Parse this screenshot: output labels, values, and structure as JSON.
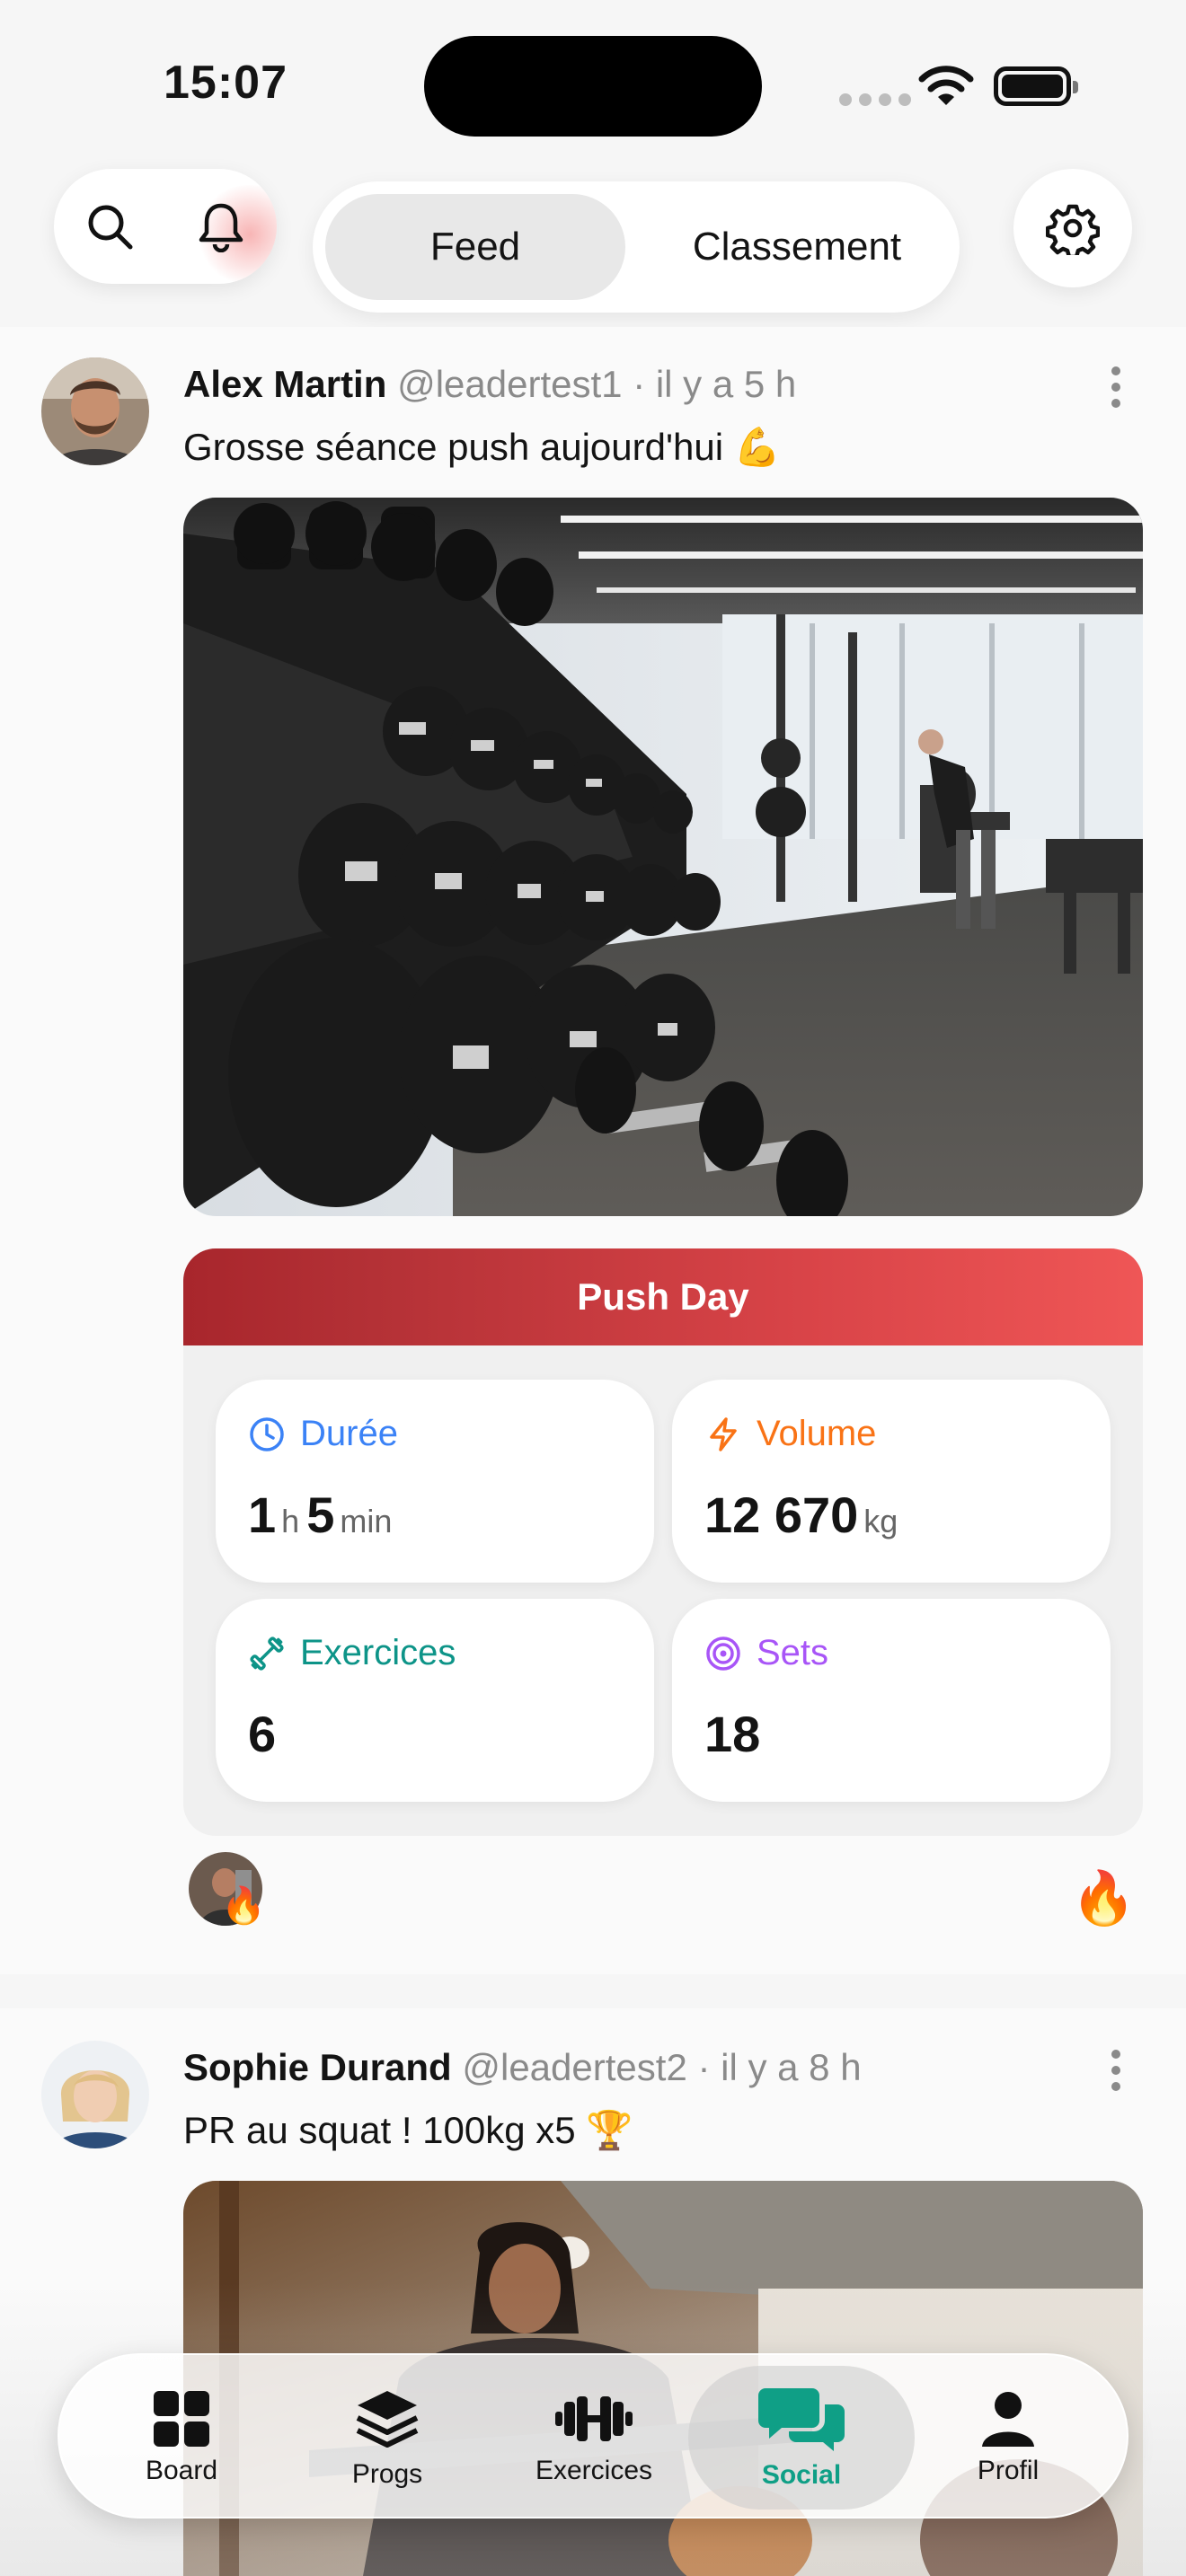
{
  "status_bar": {
    "time": "15:07"
  },
  "header": {
    "tabs": [
      {
        "label": "Feed",
        "active": true
      },
      {
        "label": "Classement",
        "active": false
      }
    ]
  },
  "posts": [
    {
      "name": "Alex Martin",
      "handle": "@leadertest1",
      "time": "· il y a 5 h",
      "text": "Grosse séance push aujourd'hui 💪",
      "workout": {
        "title": "Push Day",
        "stats": [
          {
            "label": "Durée",
            "value_h": "1",
            "unit_h": "h",
            "value_m": "5",
            "unit_m": "min",
            "color": "#3b82f6"
          },
          {
            "label": "Volume",
            "value": "12 670",
            "unit": "kg",
            "color": "#f97316"
          },
          {
            "label": "Exercices",
            "value": "6",
            "color": "#0d9488"
          },
          {
            "label": "Sets",
            "value": "18",
            "color": "#a855f7"
          }
        ]
      },
      "reaction_emoji": "🔥",
      "reaction_button": "🔥"
    },
    {
      "name": "Sophie Durand",
      "handle": "@leadertest2",
      "time": "· il y a 8 h",
      "text": "PR au squat ! 100kg x5 🏆"
    }
  ],
  "nav": {
    "items": [
      {
        "label": "Board",
        "icon": "grid-icon"
      },
      {
        "label": "Progs",
        "icon": "layers-icon"
      },
      {
        "label": "Exercices",
        "icon": "dumbbell-icon"
      },
      {
        "label": "Social",
        "icon": "chat-bubbles-icon",
        "active": true
      },
      {
        "label": "Profil",
        "icon": "person-icon"
      }
    ],
    "active_color": "#0f9f86"
  },
  "colors": {
    "accent_red": "#d94448",
    "background": "#f6f6f6"
  }
}
